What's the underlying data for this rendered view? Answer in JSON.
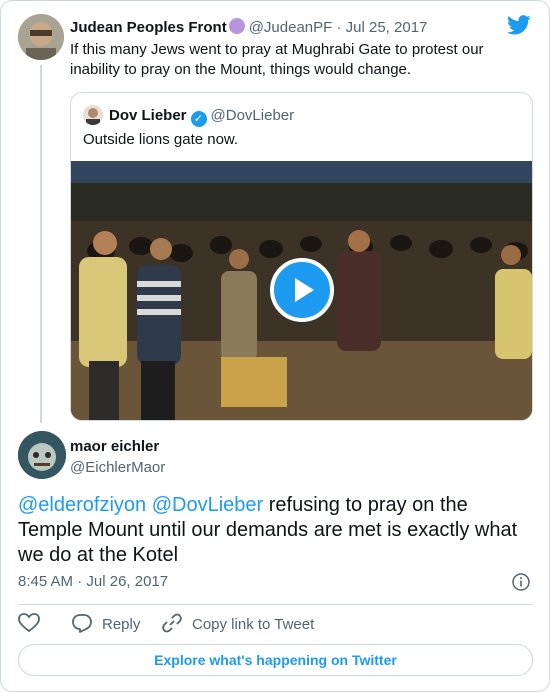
{
  "colors": {
    "accent": "#1d9bf0",
    "text": "#0f1419",
    "muted": "#536471",
    "border": "#cfd9de"
  },
  "parent_tweet": {
    "display_name": "Judean Peoples Front",
    "handle": "@JudeanPF",
    "separator": "·",
    "date": "Jul 25, 2017",
    "text": "If this many Jews went to pray at Mughrabi Gate to protest our inability to pray on the Mount, things would change.",
    "quoted": {
      "display_name": "Dov Lieber",
      "handle": "@DovLieber",
      "text": "Outside lions gate now."
    }
  },
  "reply": {
    "display_name": "maor eichler",
    "handle": "@EichlerMaor",
    "mention_1": "@elderofziyon",
    "mention_2": "@DovLieber",
    "text": " refusing to pray on the Temple Mount until our demands are met is exactly what we do at the Kotel",
    "time": "8:45 AM",
    "separator": "·",
    "date": "Jul 26, 2017"
  },
  "actions": {
    "reply_label": "Reply",
    "copy_link_label": "Copy link to Tweet"
  },
  "footer": {
    "explore_label": "Explore what's happening on Twitter"
  },
  "icons": [
    "twitter-bird-icon",
    "verified-icon",
    "play-icon",
    "info-icon",
    "heart-icon",
    "reply-icon",
    "link-icon"
  ]
}
